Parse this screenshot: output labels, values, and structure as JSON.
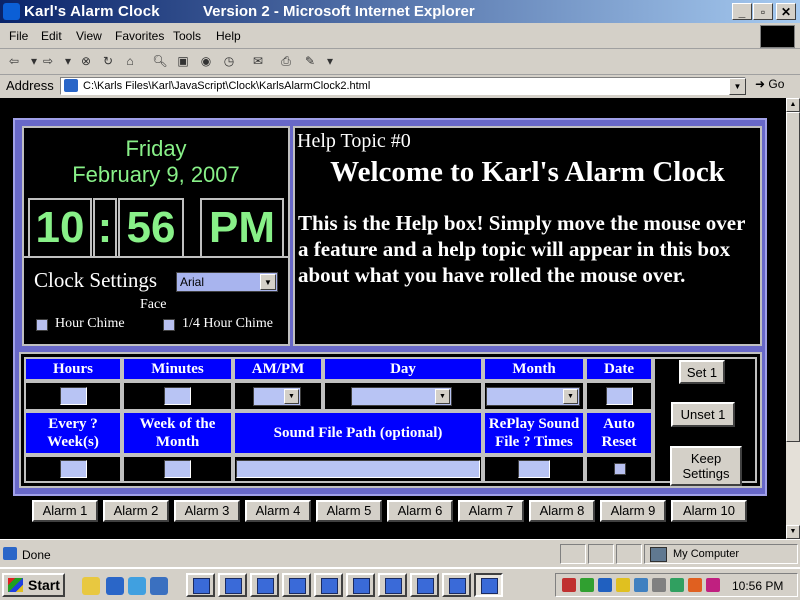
{
  "window": {
    "title": "Karl's Alarm Clock",
    "title_suffix": "Version 2 - Microsoft Internet Explorer"
  },
  "menu": [
    "File",
    "Edit",
    "View",
    "Favorites",
    "Tools",
    "Help"
  ],
  "address": {
    "label": "Address",
    "url": "C:\\Karls Files\\Karl\\JavaScript\\Clock\\KarlsAlarmClock2.html",
    "go_label": "Go"
  },
  "clock": {
    "day": "Friday",
    "date": "February 9, 2007",
    "hour": "10",
    "separator": ":",
    "minute": "56",
    "ampm": "PM"
  },
  "settings": {
    "label": "Clock Settings",
    "font_value": "Arial",
    "face_label": "Face",
    "hour_chime": "Hour Chime",
    "quarter_chime": "1/4 Hour Chime"
  },
  "help": {
    "topic": "Help Topic #0",
    "heading": "Welcome to Karl's Alarm Clock",
    "body": "This is the Help box! Simply move the mouse over a feature and a help topic will appear in this box about what you have rolled the mouse over."
  },
  "alarm_form": {
    "headers_row1": [
      "Hours",
      "Minutes",
      "AM/PM",
      "Day",
      "Month",
      "Date"
    ],
    "headers_row2": [
      "Every ? Week(s)",
      "Week of the Month",
      "Sound File Path (optional)",
      "RePlay Sound File ? Times",
      "Auto Reset"
    ],
    "buttons": {
      "set": "Set 1",
      "unset": "Unset 1",
      "keep": "Keep Settings"
    }
  },
  "alarm_tabs": [
    "Alarm 1",
    "Alarm 2",
    "Alarm 3",
    "Alarm 4",
    "Alarm 5",
    "Alarm 6",
    "Alarm 7",
    "Alarm 8",
    "Alarm 9",
    "Alarm 10"
  ],
  "status": {
    "text": "Done",
    "zone": "My Computer"
  },
  "taskbar": {
    "start": "Start",
    "time": "10:56 PM"
  },
  "colors": {
    "clock_green": "#88f088",
    "header_blue": "#0000ff",
    "frame_purple": "#6868c8"
  }
}
